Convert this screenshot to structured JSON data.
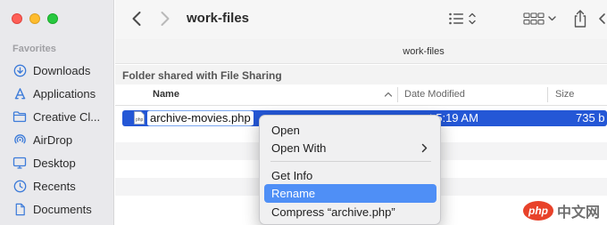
{
  "sidebar": {
    "section_title": "Favorites",
    "items": [
      {
        "label": "Downloads",
        "icon": "download-icon"
      },
      {
        "label": "Applications",
        "icon": "applications-icon"
      },
      {
        "label": "Creative Cl...",
        "icon": "folder-icon"
      },
      {
        "label": "AirDrop",
        "icon": "airdrop-icon"
      },
      {
        "label": "Desktop",
        "icon": "desktop-icon"
      },
      {
        "label": "Recents",
        "icon": "clock-icon"
      },
      {
        "label": "Documents",
        "icon": "document-icon"
      }
    ]
  },
  "toolbar": {
    "title": "work-files"
  },
  "pathbar": {
    "title": "work-files",
    "shared_label": "Folder shared with File Sharing"
  },
  "columns": {
    "name": "Name",
    "date": "Date Modified",
    "size": "Size"
  },
  "selected_file": {
    "name": "archive-movies.php",
    "date_partial": "t 5:19 AM",
    "size_partial": "735 b"
  },
  "context_menu": {
    "items": [
      {
        "label": "Open"
      },
      {
        "label": "Open With",
        "submenu": true
      },
      {
        "label": "Get Info"
      },
      {
        "label": "Rename",
        "highlighted": true
      },
      {
        "label": "Compress “archive.php”"
      }
    ]
  },
  "watermark": {
    "badge": "php",
    "text": "中文网"
  },
  "colors": {
    "accent": "#2457d6",
    "menu_highlight": "#4f8ff6"
  }
}
